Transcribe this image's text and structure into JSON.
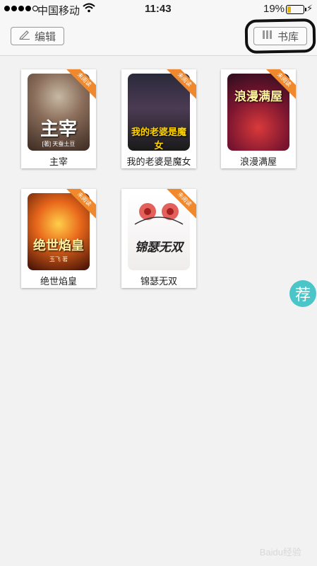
{
  "status_bar": {
    "carrier": "中国移动",
    "time": "11:43",
    "battery": "19%",
    "battery_level": 0.19
  },
  "header": {
    "edit_label": "编辑",
    "library_label": "书库"
  },
  "books": [
    {
      "title": "主宰",
      "badge": "未阅读",
      "cover_text": "主宰",
      "cover_sub": "[著] 天蚕土豆"
    },
    {
      "title": "我的老婆是魔女",
      "badge": "未阅读",
      "cover_text": "我的老婆是魔女",
      "cover_sub": ""
    },
    {
      "title": "浪漫满屋",
      "badge": "未阅读",
      "cover_text": "浪漫满屋",
      "cover_sub": ""
    },
    {
      "title": "绝世焰皇",
      "badge": "未阅读",
      "cover_text": "绝世焰皇",
      "cover_sub": "玉飞 著"
    },
    {
      "title": "锦瑟无双",
      "badge": "未阅读",
      "cover_text": "锦瑟无双",
      "cover_sub": ""
    }
  ],
  "recommend_label": "荐",
  "watermark": "Baidu经验"
}
